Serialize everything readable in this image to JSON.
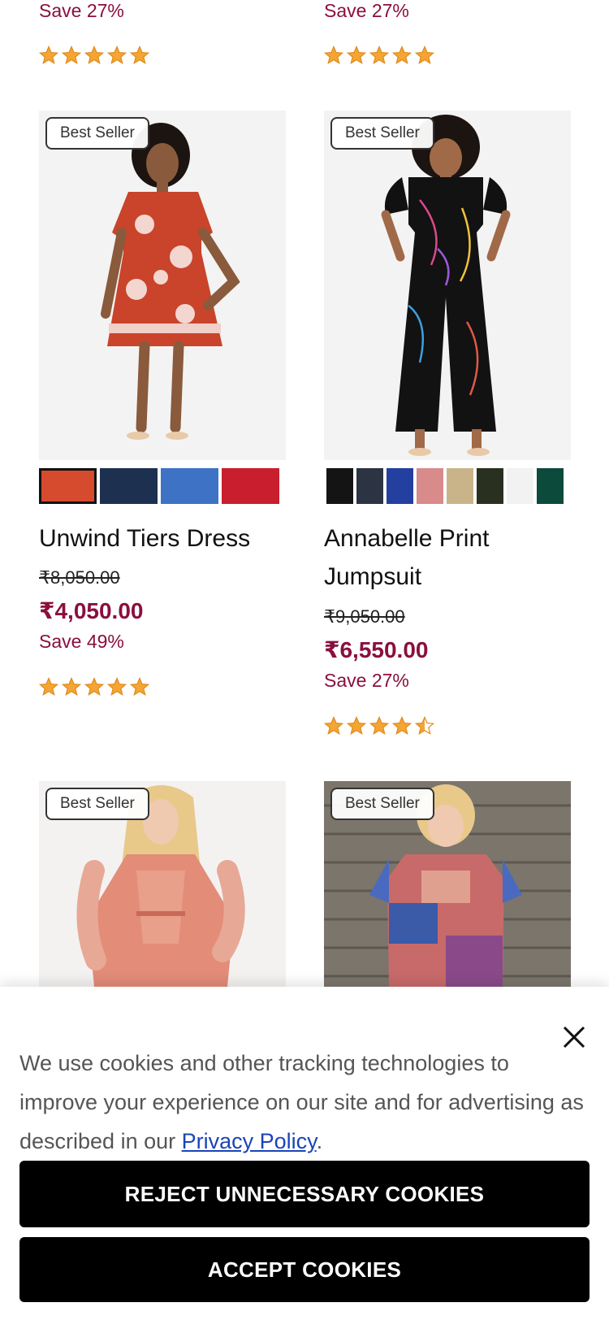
{
  "top_row": [
    {
      "save": "Save 27%",
      "rating": 5
    },
    {
      "save": "Save 27%",
      "rating": 5
    }
  ],
  "products": [
    {
      "badge": "Best Seller",
      "name": "Unwind Tiers Dress",
      "original_price": "₹8,050.00",
      "price": "₹4,050.00",
      "save": "Save 49%",
      "rating": 5,
      "swatch_colors": [
        "#d64a2e",
        "#1e3050",
        "#3d72c4",
        "#c81e2e"
      ]
    },
    {
      "badge": "Best Seller",
      "name": "Annabelle Print Jumpsuit",
      "original_price": "₹9,050.00",
      "price": "₹6,550.00",
      "save": "Save 27%",
      "rating": 4.5,
      "swatch_colors": [
        "#141414",
        "#2c3342",
        "#2340a0",
        "#d98a8a",
        "#c9b48a",
        "#2a3020",
        "#f2f2f2",
        "#0c4a3c"
      ]
    },
    {
      "badge": "Best Seller"
    },
    {
      "badge": "Best Seller"
    }
  ],
  "cookie_banner": {
    "text": "We use cookies and other tracking technologies to improve your experience on our site and for advertising as described in our ",
    "link": "Privacy Policy",
    "text_end": ".",
    "reject_label": "REJECT UNNECESSARY COOKIES",
    "accept_label": "ACCEPT COOKIES"
  },
  "colors": {
    "accent": "#8a0f3e",
    "star": "#f4a534",
    "link": "#1a44b8"
  }
}
